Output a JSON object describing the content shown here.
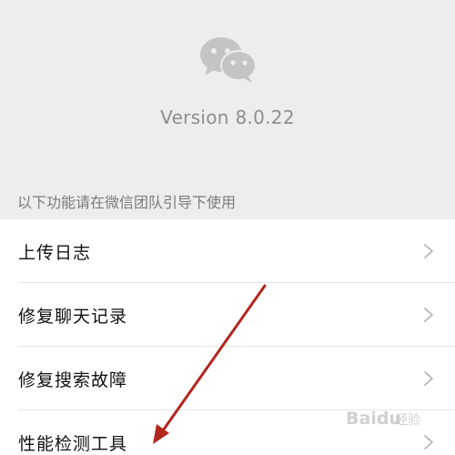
{
  "header": {
    "version_text": "Version 8.0.22",
    "logo_icon": "wechat-logo-icon"
  },
  "section": {
    "title": "以下功能请在微信团队引导下使用"
  },
  "menu": {
    "items": [
      {
        "label": "上传日志",
        "icon": "chevron-right-icon"
      },
      {
        "label": "修复聊天记录",
        "icon": "chevron-right-icon"
      },
      {
        "label": "修复搜索故障",
        "icon": "chevron-right-icon"
      },
      {
        "label": "性能检测工具",
        "icon": "chevron-right-icon"
      }
    ]
  },
  "annotation": {
    "arrow_color": "#b3261e"
  },
  "watermark": {
    "brand": "Baidu",
    "suffix": "经验"
  },
  "colors": {
    "background": "#ededed",
    "list_background": "#ffffff",
    "logo_gray": "#c4c4c4",
    "secondary_text": "#8d8d8d"
  }
}
